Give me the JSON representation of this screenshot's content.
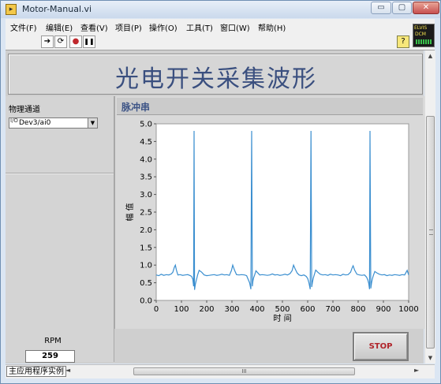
{
  "window": {
    "title": "Motor-Manual.vi",
    "minimize_glyph": "▭",
    "maximize_glyph": "▢",
    "close_glyph": "✕"
  },
  "menu": {
    "items": [
      "文件(F)",
      "编辑(E)",
      "查看(V)",
      "项目(P)",
      "操作(O)",
      "工具(T)",
      "窗口(W)",
      "帮助(H)"
    ]
  },
  "toolbar": {
    "run_glyph": "➔",
    "run_continuous_glyph": "⟳",
    "abort_glyph": "●",
    "pause_glyph": "❚❚",
    "help_glyph": "?",
    "elvis_line1": "ELVIS",
    "elvis_line2": "DCM"
  },
  "panel": {
    "title": "光电开关采集波形",
    "channel_label": "物理通道",
    "channel_value": "Dev3/ai0",
    "channel_io_glyph": "I/O",
    "channel_dropdown_glyph": "▼",
    "rpm_label": "RPM",
    "rpm_value": "259",
    "stop_label": "STOP"
  },
  "scrollbars": {
    "up_glyph": "▲",
    "down_glyph": "▼",
    "left_glyph": "◄",
    "right_glyph": "►",
    "grip_glyph": "III"
  },
  "status": {
    "label": "主应用程序实例"
  },
  "colors": {
    "plot_line": "#3b8fd0",
    "plot_background": "#ffffff",
    "title_text": "#3a4f7f",
    "stop_text": "#b0242a"
  },
  "chart_data": {
    "type": "line",
    "title": "脉冲串",
    "xlabel": "时 间",
    "ylabel": "幅 值",
    "xlim": [
      0,
      1000
    ],
    "ylim": [
      0,
      5
    ],
    "x_ticks": [
      0,
      100,
      200,
      300,
      400,
      500,
      600,
      700,
      800,
      900,
      1000
    ],
    "y_ticks": [
      "0.0",
      "0.5",
      "1.0",
      "1.5",
      "2.0",
      "2.5",
      "3.0",
      "3.5",
      "4.0",
      "4.5",
      "5.0"
    ],
    "grid": false,
    "series": [
      {
        "x": [
          0,
          10,
          20,
          30,
          40,
          50,
          60,
          66,
          72,
          76,
          80,
          86,
          95,
          105,
          115,
          125,
          135,
          140,
          145,
          148,
          150,
          152,
          155,
          158,
          160,
          164,
          170,
          180,
          190,
          200,
          210,
          220,
          230,
          240,
          250,
          260,
          270,
          280,
          290,
          298,
          303,
          310,
          318,
          328,
          338,
          350,
          358,
          364,
          370,
          375,
          378,
          381,
          383,
          386,
          390,
          395,
          400,
          410,
          420,
          430,
          440,
          450,
          460,
          470,
          480,
          490,
          500,
          510,
          520,
          530,
          538,
          544,
          550,
          558,
          566,
          575,
          585,
          594,
          600,
          605,
          610,
          613,
          616,
          619,
          622,
          626,
          632,
          640,
          650,
          660,
          670,
          680,
          690,
          700,
          710,
          720,
          730,
          740,
          750,
          760,
          770,
          776,
          780,
          786,
          795,
          805,
          815,
          825,
          833,
          838,
          842,
          845,
          847,
          850,
          853,
          856,
          860,
          866,
          874,
          884,
          894,
          904,
          914,
          924,
          934,
          944,
          954,
          964,
          974,
          984,
          994,
          1000
        ],
        "y": [
          0.72,
          0.7,
          0.74,
          0.71,
          0.73,
          0.72,
          0.75,
          0.8,
          0.94,
          1.0,
          0.86,
          0.72,
          0.73,
          0.71,
          0.72,
          0.73,
          0.7,
          0.68,
          0.6,
          0.4,
          4.8,
          0.3,
          0.45,
          0.55,
          0.6,
          0.72,
          0.85,
          0.8,
          0.72,
          0.7,
          0.71,
          0.72,
          0.73,
          0.71,
          0.72,
          0.74,
          0.72,
          0.73,
          0.71,
          0.85,
          1.0,
          0.86,
          0.73,
          0.72,
          0.73,
          0.72,
          0.7,
          0.6,
          0.5,
          0.32,
          4.8,
          0.4,
          0.55,
          0.64,
          0.72,
          0.84,
          0.8,
          0.72,
          0.73,
          0.72,
          0.71,
          0.72,
          0.75,
          0.72,
          0.73,
          0.71,
          0.72,
          0.74,
          0.72,
          0.76,
          0.84,
          1.0,
          0.9,
          0.78,
          0.72,
          0.7,
          0.72,
          0.68,
          0.62,
          0.5,
          0.32,
          4.8,
          0.38,
          0.52,
          0.62,
          0.72,
          0.86,
          0.8,
          0.74,
          0.72,
          0.73,
          0.71,
          0.74,
          0.72,
          0.73,
          0.72,
          0.7,
          0.74,
          0.72,
          0.73,
          0.8,
          0.92,
          0.98,
          0.86,
          0.74,
          0.72,
          0.71,
          0.72,
          0.66,
          0.58,
          0.48,
          0.32,
          4.8,
          0.34,
          0.5,
          0.6,
          0.7,
          0.82,
          0.78,
          0.74,
          0.72,
          0.73,
          0.7,
          0.72,
          0.71,
          0.73,
          0.72,
          0.71,
          0.73,
          0.72,
          0.85,
          0.72
        ]
      }
    ]
  }
}
